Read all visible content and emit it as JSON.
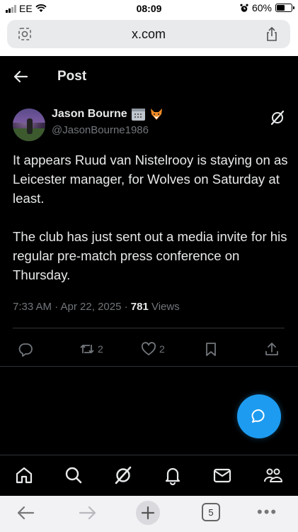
{
  "status_bar": {
    "carrier": "EE",
    "time": "08:09",
    "battery": "60%",
    "battery_level": 0.6
  },
  "browser": {
    "url": "x.com"
  },
  "header": {
    "title": "Post"
  },
  "post": {
    "author_name": "Jason Bourne",
    "handle": "@JasonBourne1986",
    "paragraphs": [
      "It appears Ruud van Nistelrooy is staying on as Leicester manager, for Wolves on Saturday at least.",
      "The club has just sent out a media invite for his regular pre-match press conference on Thursday."
    ],
    "timestamp": "7:33 AM · Apr 22, 2025 · ",
    "views_count": "781",
    "views_label": " Views",
    "retweets": "2",
    "likes": "2"
  },
  "safari": {
    "tab_count": "5",
    "more": "•••"
  },
  "colors": {
    "accent": "#1d9bf0",
    "background": "#000000",
    "muted": "#71767b",
    "text": "#e7e9ea"
  },
  "icons": {
    "header": [
      "back-arrow-icon"
    ],
    "post": [
      "grok-icon"
    ],
    "actions": [
      "reply-icon",
      "retweet-icon",
      "like-icon",
      "bookmark-icon",
      "share-icon"
    ],
    "fab": "compose-message-icon",
    "tabs": [
      "home-icon",
      "search-icon",
      "grok-icon",
      "notifications-icon",
      "messages-icon",
      "communities-icon"
    ],
    "safari": [
      "back-icon",
      "forward-icon",
      "new-tab-icon",
      "tabs-icon",
      "more-icon"
    ]
  }
}
